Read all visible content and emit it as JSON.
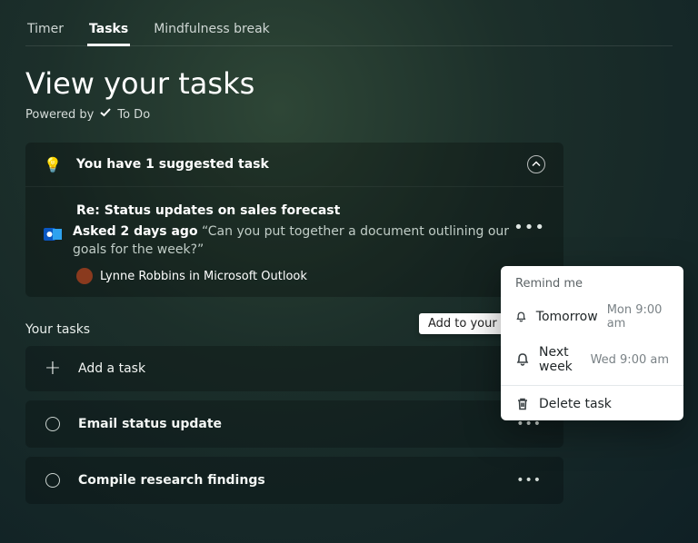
{
  "tabs": {
    "timer": "Timer",
    "tasks": "Tasks",
    "mindfulness": "Mindfulness break"
  },
  "header": {
    "title": "View your tasks",
    "powered_by_prefix": "Powered by",
    "powered_by_app": "To Do"
  },
  "suggested": {
    "banner": "You have 1 suggested task",
    "subject": "Re: Status updates on sales forecast",
    "asked_prefix": "Asked 2 days ago",
    "quote": "“Can you put together a document outlining our goals for the week?”",
    "from": "Lynne Robbins in Microsoft Outlook",
    "tooltip": "Add to your tasks",
    "icons": {
      "bulb": "💡"
    }
  },
  "menu": {
    "heading": "Remind me",
    "items": [
      {
        "label": "Tomorrow",
        "time": "Mon 9:00 am"
      },
      {
        "label": "Next week",
        "time": "Wed 9:00 am"
      }
    ],
    "delete": "Delete task"
  },
  "your_tasks": {
    "heading": "Your tasks",
    "add_label": "Add a task",
    "items": [
      {
        "label": "Email status update"
      },
      {
        "label": "Compile research findings"
      }
    ]
  }
}
